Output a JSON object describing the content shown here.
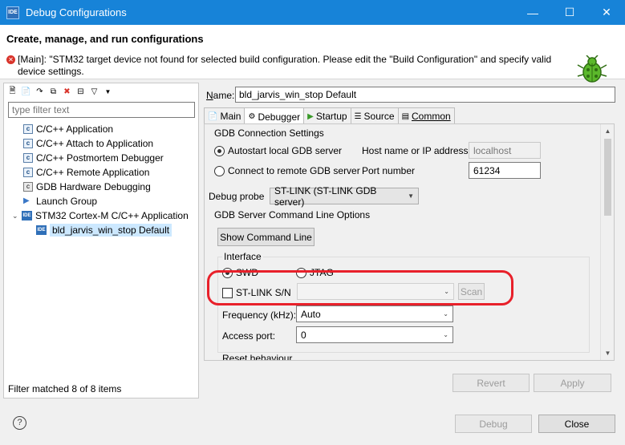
{
  "window": {
    "title": "Debug Configurations",
    "app_icon_label": "IDE"
  },
  "header": {
    "title": "Create, manage, and run configurations",
    "error_message": "[Main]: \"STM32 target device not found for selected build configuration. Please edit the \"Build Configuration\" and specify valid device settings."
  },
  "left": {
    "filter_placeholder": "type filter text",
    "tree": [
      {
        "label": "C/C++ Application",
        "icon": "c-app-icon"
      },
      {
        "label": "C/C++ Attach to Application",
        "icon": "c-attach-icon"
      },
      {
        "label": "C/C++ Postmortem Debugger",
        "icon": "c-postmortem-icon"
      },
      {
        "label": "C/C++ Remote Application",
        "icon": "c-remote-icon"
      },
      {
        "label": "GDB Hardware Debugging",
        "icon": "gdb-hw-icon"
      },
      {
        "label": "Launch Group",
        "icon": "launch-group-icon"
      },
      {
        "label": "STM32 Cortex-M C/C++ Application",
        "icon": "stm32-icon"
      },
      {
        "label": "bld_jarvis_win_stop Default",
        "icon": "ide-config-icon"
      }
    ],
    "status": "Filter matched 8 of 8 items"
  },
  "right": {
    "name_label": "Name:",
    "name_value": "bld_jarvis_win_stop Default",
    "tabs": [
      "Main",
      "Debugger",
      "Startup",
      "Source",
      "Common"
    ],
    "active_tab": "Debugger",
    "gdb_group_title": "GDB Connection Settings",
    "autostart_label": "Autostart local GDB server",
    "remote_label": "Connect to remote GDB server",
    "host_label": "Host name or IP address",
    "host_value": "localhost",
    "port_label": "Port number",
    "port_value": "61234",
    "probe_label": "Debug probe",
    "probe_value": "ST-LINK (ST-LINK GDB server)",
    "server_options_title": "GDB Server Command Line Options",
    "show_cmd_label": "Show Command Line",
    "interface_title": "Interface",
    "swd_label": "SWD",
    "jtag_label": "JTAG",
    "stlink_sn_label": "ST-LINK S/N",
    "scan_label": "Scan",
    "freq_label": "Frequency (kHz):",
    "freq_value": "Auto",
    "access_label": "Access port:",
    "access_value": "0",
    "reset_title": "Reset behaviour",
    "revert_label": "Revert",
    "apply_label": "Apply"
  },
  "footer": {
    "debug_label": "Debug",
    "close_label": "Close"
  },
  "colors": {
    "titlebar": "#1783d8",
    "highlight": "#e8202a",
    "selection": "#cce8ff"
  }
}
